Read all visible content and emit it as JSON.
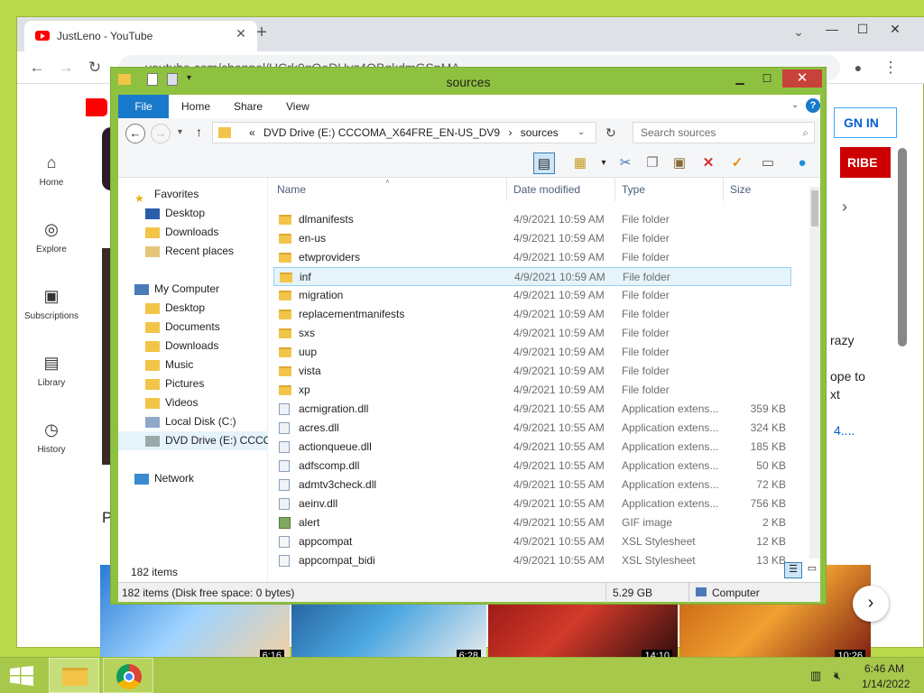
{
  "browser": {
    "tab_title": "JustLeno - YouTube",
    "url": "youtube.com/channel/UCrk0gQeDUvz4QBgkdmGSpMA",
    "tab_close": "✕",
    "new_tab": "+",
    "controls": {
      "minimize": "—",
      "maximize": "☐",
      "close": "✕",
      "tab_list": "⌄"
    }
  },
  "youtube": {
    "sidebar": [
      {
        "label": "Home",
        "icon": "⌂"
      },
      {
        "label": "Explore",
        "icon": "◎"
      },
      {
        "label": "Subscriptions",
        "icon": "▣"
      },
      {
        "label": "Library",
        "icon": "▤"
      },
      {
        "label": "History",
        "icon": "◷"
      }
    ],
    "sign_in": "GN IN",
    "subscribe": "RIBE",
    "snippet_1": "razy",
    "snippet_2": "ope to",
    "snippet_3": "xt",
    "snippet_4": "4....",
    "snippet_p": "P",
    "thumb_times": [
      "6:16",
      "6:28",
      "14:10",
      "10:26"
    ]
  },
  "explorer": {
    "title": "sources",
    "ribbon_tabs": {
      "file": "File",
      "home": "Home",
      "share": "Share",
      "view": "View"
    },
    "address": {
      "prefix": "«",
      "drive": "DVD Drive (E:) CCCOMA_X64FRE_EN-US_DV9",
      "sep": "›",
      "folder": "sources"
    },
    "search_placeholder": "Search sources",
    "nav": {
      "favorites": "Favorites",
      "fav_items": [
        "Desktop",
        "Downloads",
        "Recent places"
      ],
      "computer": "My Computer",
      "comp_items": [
        "Desktop",
        "Documents",
        "Downloads",
        "Music",
        "Pictures",
        "Videos",
        "Local Disk (C:)",
        "DVD Drive (E:) CCCC"
      ],
      "network": "Network"
    },
    "columns": {
      "name": "Name",
      "date": "Date modified",
      "type": "Type",
      "size": "Size"
    },
    "files": [
      {
        "name": "dlmanifests",
        "date": "4/9/2021 10:59 AM",
        "type": "File folder",
        "size": "",
        "kind": "folder"
      },
      {
        "name": "en-us",
        "date": "4/9/2021 10:59 AM",
        "type": "File folder",
        "size": "",
        "kind": "folder"
      },
      {
        "name": "etwproviders",
        "date": "4/9/2021 10:59 AM",
        "type": "File folder",
        "size": "",
        "kind": "folder"
      },
      {
        "name": "inf",
        "date": "4/9/2021 10:59 AM",
        "type": "File folder",
        "size": "",
        "kind": "folder"
      },
      {
        "name": "migration",
        "date": "4/9/2021 10:59 AM",
        "type": "File folder",
        "size": "",
        "kind": "folder"
      },
      {
        "name": "replacementmanifests",
        "date": "4/9/2021 10:59 AM",
        "type": "File folder",
        "size": "",
        "kind": "folder"
      },
      {
        "name": "sxs",
        "date": "4/9/2021 10:59 AM",
        "type": "File folder",
        "size": "",
        "kind": "folder"
      },
      {
        "name": "uup",
        "date": "4/9/2021 10:59 AM",
        "type": "File folder",
        "size": "",
        "kind": "folder"
      },
      {
        "name": "vista",
        "date": "4/9/2021 10:59 AM",
        "type": "File folder",
        "size": "",
        "kind": "folder"
      },
      {
        "name": "xp",
        "date": "4/9/2021 10:59 AM",
        "type": "File folder",
        "size": "",
        "kind": "folder"
      },
      {
        "name": "acmigration.dll",
        "date": "4/9/2021 10:55 AM",
        "type": "Application extens...",
        "size": "359 KB",
        "kind": "dll"
      },
      {
        "name": "acres.dll",
        "date": "4/9/2021 10:55 AM",
        "type": "Application extens...",
        "size": "324 KB",
        "kind": "dll"
      },
      {
        "name": "actionqueue.dll",
        "date": "4/9/2021 10:55 AM",
        "type": "Application extens...",
        "size": "185 KB",
        "kind": "dll"
      },
      {
        "name": "adfscomp.dll",
        "date": "4/9/2021 10:55 AM",
        "type": "Application extens...",
        "size": "50 KB",
        "kind": "dll"
      },
      {
        "name": "admtv3check.dll",
        "date": "4/9/2021 10:55 AM",
        "type": "Application extens...",
        "size": "72 KB",
        "kind": "dll"
      },
      {
        "name": "aeinv.dll",
        "date": "4/9/2021 10:55 AM",
        "type": "Application extens...",
        "size": "756 KB",
        "kind": "dll"
      },
      {
        "name": "alert",
        "date": "4/9/2021 10:55 AM",
        "type": "GIF image",
        "size": "2 KB",
        "kind": "gif"
      },
      {
        "name": "appcompat",
        "date": "4/9/2021 10:55 AM",
        "type": "XSL Stylesheet",
        "size": "12 KB",
        "kind": "xsl"
      },
      {
        "name": "appcompat_bidi",
        "date": "4/9/2021 10:55 AM",
        "type": "XSL Stylesheet",
        "size": "13 KB",
        "kind": "xsl"
      }
    ],
    "item_count": "182 items",
    "status": {
      "left": "182 items (Disk free space: 0 bytes)",
      "size": "5.29 GB",
      "location": "Computer"
    }
  },
  "taskbar": {
    "time": "6:46 AM",
    "date": "1/14/2022"
  }
}
